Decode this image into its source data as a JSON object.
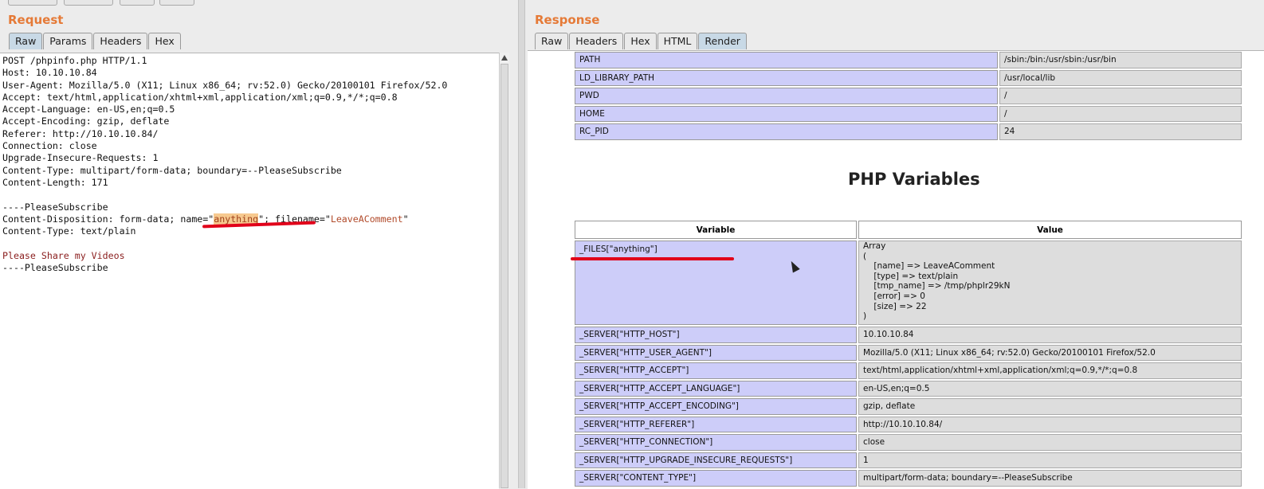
{
  "request": {
    "title": "Request",
    "tabs": [
      "Raw",
      "Params",
      "Headers",
      "Hex"
    ],
    "lines": [
      "POST /phpinfo.php HTTP/1.1",
      "Host: 10.10.10.84",
      "User-Agent: Mozilla/5.0 (X11; Linux x86_64; rv:52.0) Gecko/20100101 Firefox/52.0",
      "Accept: text/html,application/xhtml+xml,application/xml;q=0.9,*/*;q=0.8",
      "Accept-Language: en-US,en;q=0.5",
      "Accept-Encoding: gzip, deflate",
      "Referer: http://10.10.10.84/",
      "Connection: close",
      "Upgrade-Insecure-Requests: 1",
      "Content-Type: multipart/form-data; boundary=--PleaseSubscribe",
      "Content-Length: 171",
      "",
      "----PleaseSubscribe"
    ],
    "disposition": {
      "prefix": "Content-Disposition: form-data; name=\"",
      "name_value": "anything",
      "mid": "\"; filename=\"",
      "filename_value": "LeaveAComment",
      "suffix": "\""
    },
    "content_type_line": "Content-Type: text/plain",
    "body_line": "Please Share my Videos",
    "closing_boundary": "----PleaseSubscribe"
  },
  "response": {
    "title": "Response",
    "tabs": [
      "Raw",
      "Headers",
      "Hex",
      "HTML",
      "Render"
    ],
    "env_rows": [
      {
        "key": "PATH",
        "value": "/sbin:/bin:/usr/sbin:/usr/bin"
      },
      {
        "key": "LD_LIBRARY_PATH",
        "value": "/usr/local/lib"
      },
      {
        "key": "PWD",
        "value": "/"
      },
      {
        "key": "HOME",
        "value": "/"
      },
      {
        "key": "RC_PID",
        "value": "24"
      }
    ],
    "php_variables_title": "PHP Variables",
    "var_header": {
      "variable": "Variable",
      "value": "Value"
    },
    "files_row": {
      "key": "_FILES[\"anything\"]",
      "value": "Array\n(\n    [name] => LeaveAComment\n    [type] => text/plain\n    [tmp_name] => /tmp/phplr29kN\n    [error] => 0\n    [size] => 22\n)"
    },
    "server_rows": [
      {
        "key": "_SERVER[\"HTTP_HOST\"]",
        "value": "10.10.10.84"
      },
      {
        "key": "_SERVER[\"HTTP_USER_AGENT\"]",
        "value": "Mozilla/5.0 (X11; Linux x86_64; rv:52.0) Gecko/20100101 Firefox/52.0"
      },
      {
        "key": "_SERVER[\"HTTP_ACCEPT\"]",
        "value": "text/html,application/xhtml+xml,application/xml;q=0.9,*/*;q=0.8"
      },
      {
        "key": "_SERVER[\"HTTP_ACCEPT_LANGUAGE\"]",
        "value": "en-US,en;q=0.5"
      },
      {
        "key": "_SERVER[\"HTTP_ACCEPT_ENCODING\"]",
        "value": "gzip, deflate"
      },
      {
        "key": "_SERVER[\"HTTP_REFERER\"]",
        "value": "http://10.10.10.84/"
      },
      {
        "key": "_SERVER[\"HTTP_CONNECTION\"]",
        "value": "close"
      },
      {
        "key": "_SERVER[\"HTTP_UPGRADE_INSECURE_REQUESTS\"]",
        "value": "1"
      },
      {
        "key": "_SERVER[\"CONTENT_TYPE\"]",
        "value": "multipart/form-data; boundary=--PleaseSubscribe"
      }
    ]
  },
  "colors": {
    "pane_title": "#e57a37",
    "annotation_red": "#e1001a",
    "highlight": "#f6c98f",
    "key_cell": "#cdcdf9",
    "value_cell": "#dddddd"
  }
}
